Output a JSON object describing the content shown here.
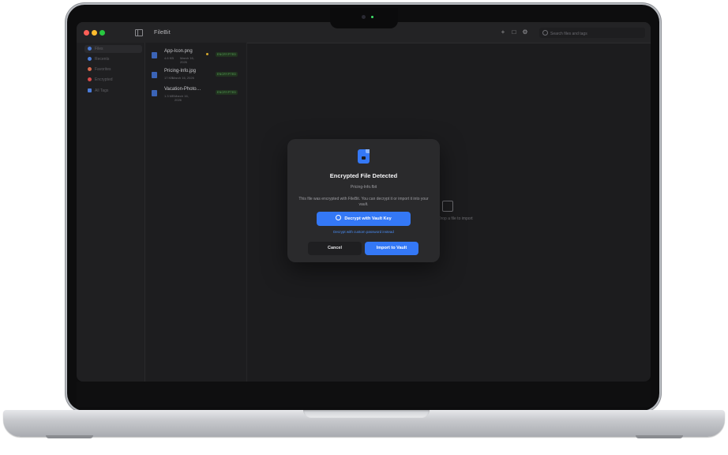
{
  "app": {
    "title": "FileBit",
    "traffic_colors": [
      "#ff5f57",
      "#febc2e",
      "#28c840"
    ]
  },
  "search": {
    "placeholder": "Search files and tags"
  },
  "sidebar": {
    "items": [
      {
        "label": "Files",
        "color": "#4a7bd8",
        "active": true
      },
      {
        "label": "Recents",
        "color": "#4a7bd8",
        "active": false
      },
      {
        "label": "Favorites",
        "color": "#d8684a",
        "active": false
      },
      {
        "label": "Encrypted",
        "color": "#d84a4a",
        "active": false
      },
      {
        "label": "All Tags",
        "color": "#4a7bd8",
        "active": false
      }
    ]
  },
  "files": [
    {
      "name": "App-Icon.png",
      "size": "4.6 KB",
      "date": "March 16, 2026",
      "badge": "ENCRYPTED",
      "starred": true
    },
    {
      "name": "Pricing-Info.jpg",
      "size": "17 KB",
      "date": "March 16, 2026",
      "badge": "ENCRYPTED",
      "starred": false
    },
    {
      "name": "Vacation-Photo…",
      "size": "1.3 MB",
      "date": "March 16, 2026",
      "badge": "ENCRYPTED",
      "starred": false
    }
  ],
  "main": {
    "drop_hint": "Drop a file to import"
  },
  "modal": {
    "title": "Encrypted File Detected",
    "filename": "Pricing-Info.fbit",
    "description": "This file was encrypted with FileBit. You can decrypt it or import it into your vault.",
    "primary_button": "Decrypt with Vault Key",
    "alt_link": "Decrypt with custom password instead",
    "cancel_button": "Cancel",
    "import_button": "Import to Vault"
  },
  "colors": {
    "accent": "#3478f6",
    "badge_text": "#58a55a",
    "background": "#1c1c1e"
  }
}
